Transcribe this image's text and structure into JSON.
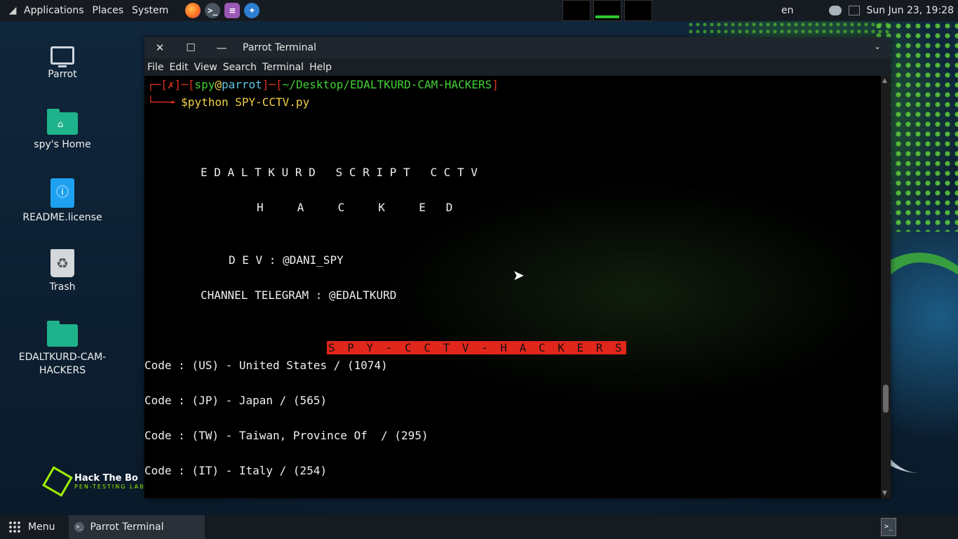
{
  "top_panel": {
    "menus": [
      "Applications",
      "Places",
      "System"
    ],
    "launchers": [
      {
        "name": "firefox-icon"
      },
      {
        "name": "terminal-icon"
      },
      {
        "name": "text-editor-icon"
      },
      {
        "name": "parrot-icon"
      }
    ],
    "keyboard_layout": "en",
    "clock": "Sun Jun 23, 19:28"
  },
  "desktop_icons": [
    {
      "label": "Parrot",
      "icon": "computer-icon"
    },
    {
      "label": "spy's Home",
      "icon": "home-folder-icon"
    },
    {
      "label": "README.license",
      "icon": "info-file-icon"
    },
    {
      "label": "Trash",
      "icon": "trash-icon"
    },
    {
      "label": "EDALTKURD-CAM-HACKERS",
      "icon": "folder-icon"
    }
  ],
  "htb": {
    "title": "Hack The Bo",
    "subtitle": "PEN-TESTING LAB"
  },
  "window": {
    "title": "Parrot Terminal",
    "menu": [
      "File",
      "Edit",
      "View",
      "Search",
      "Terminal",
      "Help"
    ]
  },
  "terminal": {
    "prompt_user": "spy",
    "prompt_host": "parrot",
    "prompt_path": "~/Desktop/EDALTKURD-CAM-HACKERS",
    "prompt_status": "✗",
    "command": "$python SPY-CCTV.py",
    "banner_line1": "E D A L T K U R D   S C R I P T   C C T V",
    "banner_line2": "H     A     C     K     E   D",
    "dev_line": "D E V : @DANI_SPY",
    "channel_line": "CHANNEL TELEGRAM : @EDALTKURD",
    "title_banner": "S P Y - C C T V - H A C K E R S",
    "codes": [
      "Code : (US) - United States / (1074)",
      "Code : (JP) - Japan / (565)",
      "Code : (TW) - Taiwan, Province Of  / (295)",
      "Code : (IT) - Italy / (254)"
    ]
  },
  "bottom_panel": {
    "menu_label": "Menu",
    "task_label": "Parrot Terminal"
  }
}
